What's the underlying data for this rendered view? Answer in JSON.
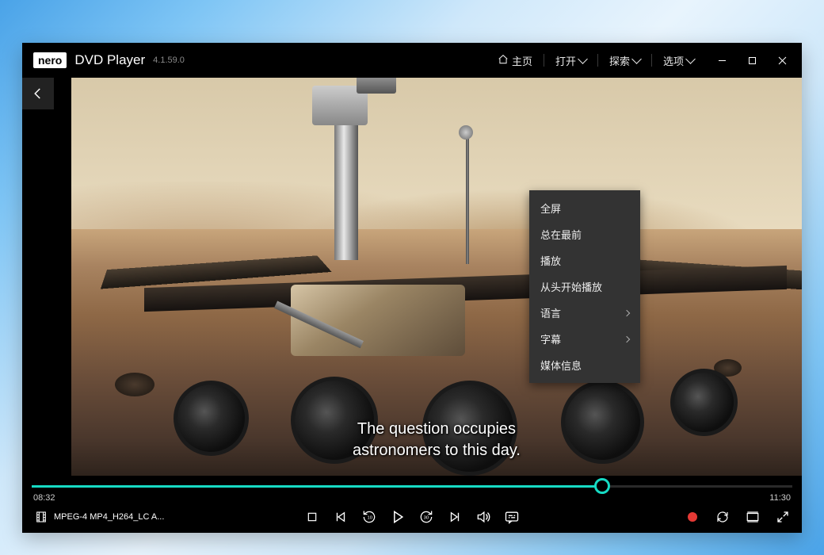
{
  "brand": "nero",
  "title": "DVD Player",
  "version": "4.1.59.0",
  "header": {
    "home": "主页",
    "open": "打开",
    "explore": "探索",
    "options": "选项"
  },
  "context_menu": {
    "fullscreen": "全屏",
    "always_on_top": "总在最前",
    "play": "播放",
    "play_from_start": "从头开始播放",
    "language": "语言",
    "subtitle": "字幕",
    "media_info": "媒体信息"
  },
  "subtitle_line1": "The question occupies",
  "subtitle_line2": "astronomers to this day.",
  "time": {
    "current": "08:32",
    "total": "11:30"
  },
  "progress_pct": 75,
  "file_name": "MPEG-4 MP4_H264_LC A...",
  "colors": {
    "accent": "#16dbc4",
    "record": "#e53935"
  }
}
